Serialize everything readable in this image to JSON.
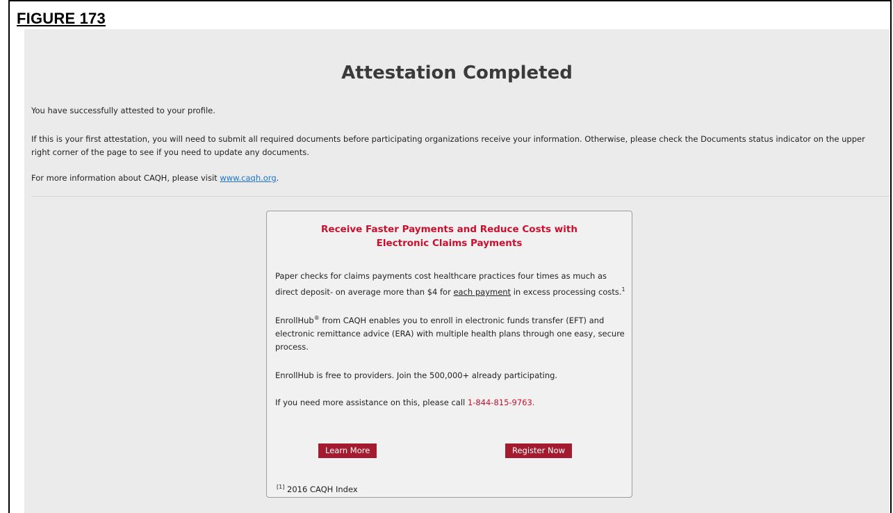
{
  "figure_label": "FIGURE 173",
  "page": {
    "title": "Attestation Completed",
    "message_1": "You have successfully attested to your profile.",
    "message_2": "If this is your first attestation, you will need to submit all required documents before participating organizations receive your information. Otherwise, please check the Documents status indicator on the upper right corner of the page to see if you need to update any documents.",
    "message_3_prefix": "For more information about CAQH, please visit ",
    "message_3_link": "www.caqh.org",
    "message_3_suffix": "."
  },
  "promo": {
    "heading_line1": "Receive Faster Payments and Reduce Costs with",
    "heading_line2": "Electronic Claims Payments",
    "p1_before": "Paper checks for claims payments cost healthcare practices four times as much as direct deposit- on average more than $4 for ",
    "p1_emph": "each payment",
    "p1_after": " in excess processing costs.",
    "p1_footnote_marker": "1",
    "p2_brand": "EnrollHub",
    "p2_trademark": "®",
    "p2_text": " from CAQH enables you to enroll in electronic funds transfer (EFT) and electronic remittance advice (ERA) with multiple health plans through one easy, secure process.",
    "p3": "EnrollHub is free to providers. Join the 500,000+ already participating.",
    "p4_prefix": "If you need more assistance on this, please call ",
    "p4_phone": "1-844-815-9763.",
    "learn_more_label": "Learn More",
    "register_now_label": "Register Now",
    "footnote_marker": "[1]",
    "footnote_text": " 2016 CAQH Index"
  },
  "colors": {
    "accent_red": "#c8102e",
    "button_bg": "#a31b2e",
    "link_blue": "#1a73c8",
    "page_bg": "#ebebeb"
  }
}
